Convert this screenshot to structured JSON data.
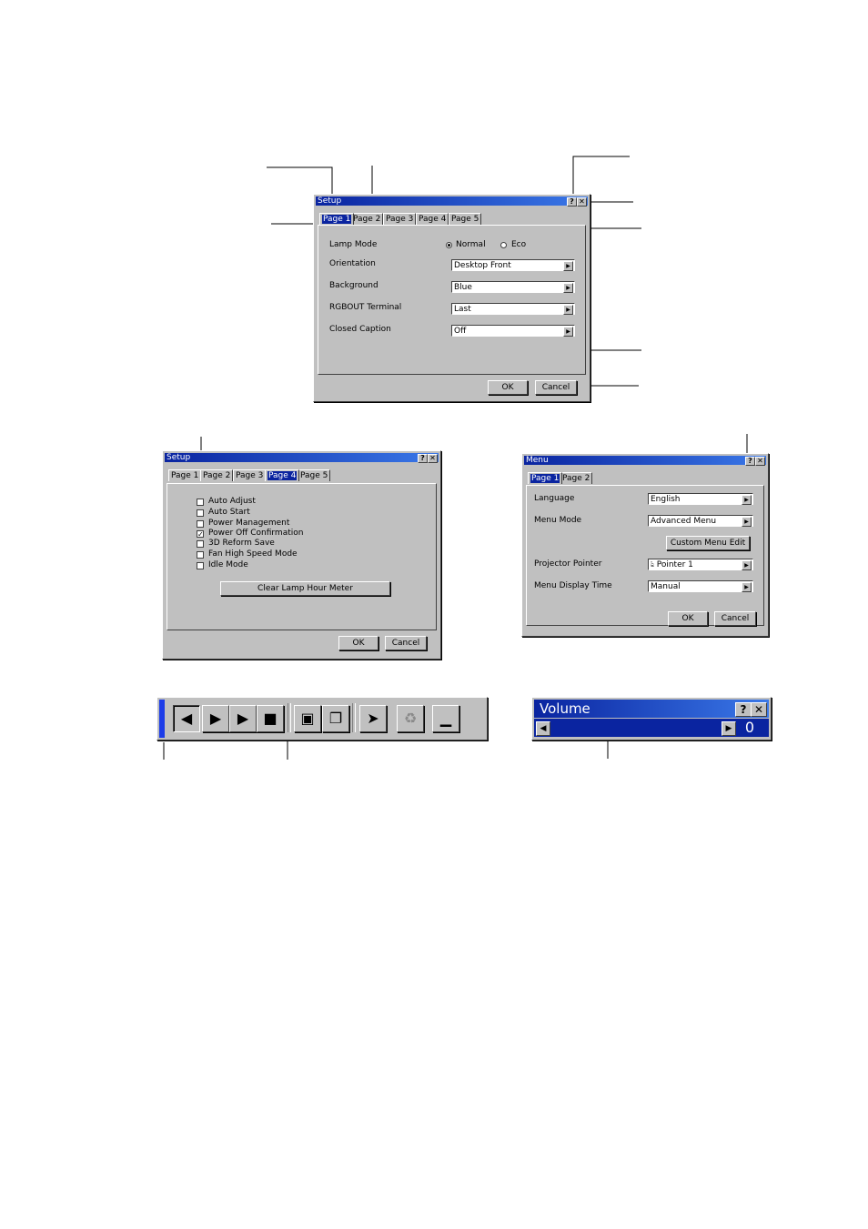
{
  "setup1": {
    "title": "Setup",
    "tabs": [
      "Page 1",
      "Page 2",
      "Page 3",
      "Page 4",
      "Page 5"
    ],
    "lamp_mode_label": "Lamp Mode",
    "lamp_normal": "Normal",
    "lamp_eco": "Eco",
    "rows": [
      {
        "label": "Orientation",
        "value": "Desktop Front"
      },
      {
        "label": "Background",
        "value": "Blue"
      },
      {
        "label": "RGBOUT Terminal",
        "value": "Last"
      },
      {
        "label": "Closed Caption",
        "value": "Off"
      }
    ],
    "ok": "OK",
    "cancel": "Cancel"
  },
  "setup4": {
    "title": "Setup",
    "tabs": [
      "Page 1",
      "Page 2",
      "Page 3",
      "Page 4",
      "Page 5"
    ],
    "checks": [
      {
        "label": "Auto Adjust",
        "checked": false
      },
      {
        "label": "Auto Start",
        "checked": false
      },
      {
        "label": "Power Management",
        "checked": false
      },
      {
        "label": "Power Off Confirmation",
        "checked": true
      },
      {
        "label": "3D Reform Save",
        "checked": false
      },
      {
        "label": "Fan High Speed Mode",
        "checked": false
      },
      {
        "label": "Idle Mode",
        "checked": false
      }
    ],
    "clear_button": "Clear Lamp Hour Meter",
    "ok": "OK",
    "cancel": "Cancel"
  },
  "menu": {
    "title": "Menu",
    "tabs": [
      "Page 1",
      "Page 2"
    ],
    "language_label": "Language",
    "language_value": "English",
    "menu_mode_label": "Menu Mode",
    "menu_mode_value": "Advanced Menu",
    "custom_button": "Custom Menu Edit",
    "pointer_label": "Projector Pointer",
    "pointer_value": "Pointer 1",
    "display_time_label": "Menu Display Time",
    "display_time_value": "Manual",
    "ok": "OK",
    "cancel": "Cancel"
  },
  "volume": {
    "title": "Volume",
    "value": "0"
  },
  "icons": {
    "help": "?",
    "close": "✕",
    "dropdown": "▶",
    "check": "✓",
    "toolbar": [
      "previous-icon",
      "next-icon",
      "play-icon",
      "stop-icon",
      "fullscreen-icon",
      "window-icon",
      "pointer-icon",
      "trash-icon",
      "minimize-icon"
    ]
  },
  "colors": {
    "title_bar": "#0a24a0",
    "toolbar_handle": "#1c3ce8",
    "face": "#c0c0c0"
  }
}
